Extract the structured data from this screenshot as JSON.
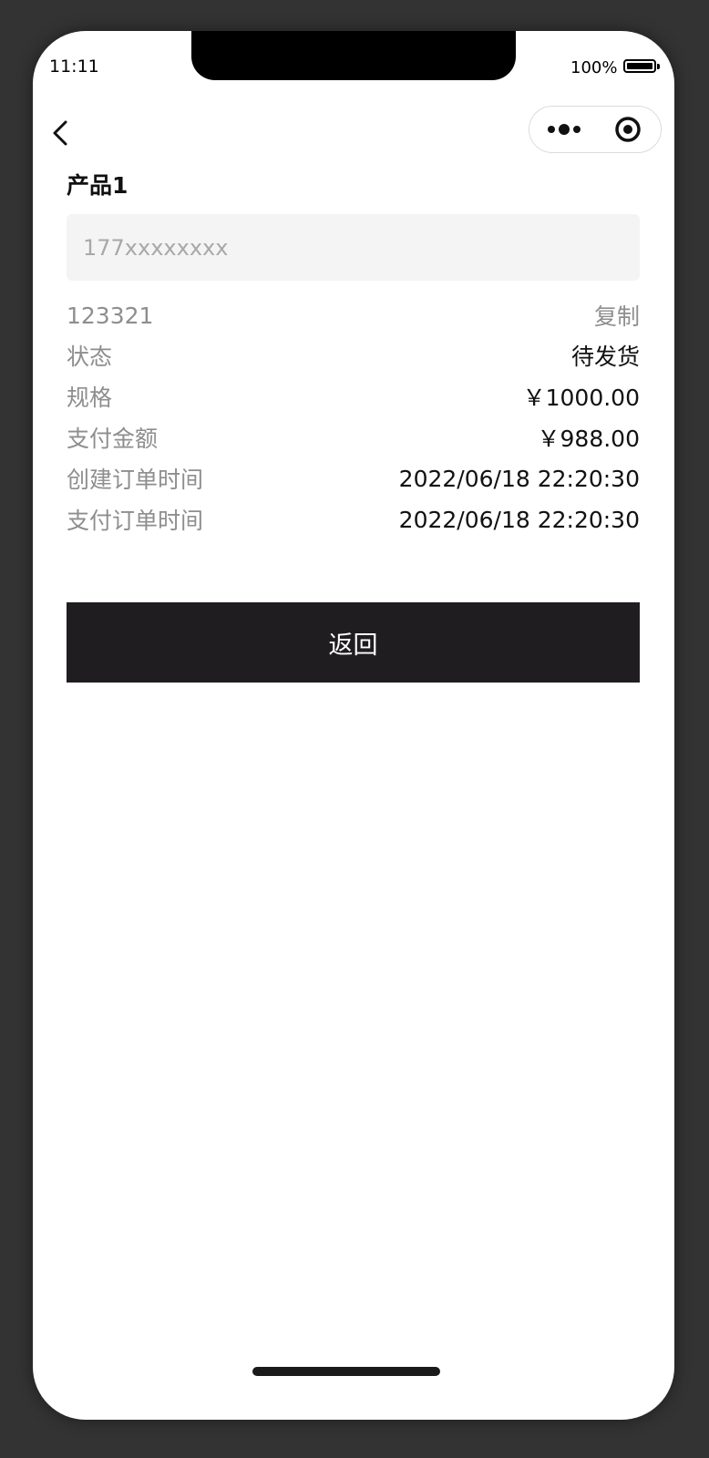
{
  "status_bar": {
    "time": "11:11",
    "battery": "100%"
  },
  "nav": {
    "back_icon": "chevron-left-icon",
    "capsule_more_icon": "more-dots-icon",
    "capsule_close_icon": "target-circle-icon"
  },
  "order": {
    "product_name": "产品1",
    "phone_placeholder": "177xxxxxxxx",
    "order_number": "123321",
    "copy_label": "复制",
    "rows": [
      {
        "label": "状态",
        "value": "待发货"
      },
      {
        "label": "规格",
        "value": "￥1000.00"
      },
      {
        "label": "支付金额",
        "value": "￥988.00"
      },
      {
        "label": "创建订单时间",
        "value": "2022/06/18 22:20:30"
      },
      {
        "label": "支付订单时间",
        "value": "2022/06/18 22:20:30"
      }
    ]
  },
  "actions": {
    "return_label": "返回"
  },
  "colors": {
    "button_bg": "#1f1d1f",
    "label": "#8e8e8e",
    "input_bg": "#f4f4f4"
  }
}
